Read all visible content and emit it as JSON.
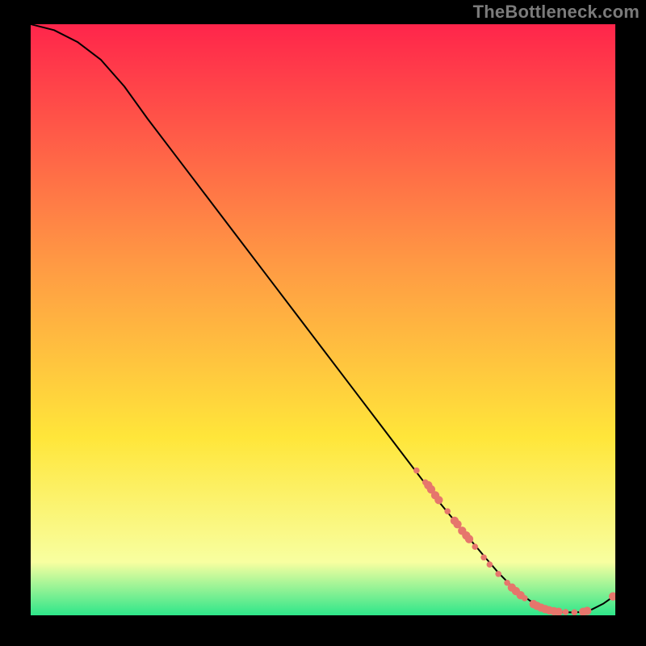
{
  "attribution": "TheBottleneck.com",
  "colors": {
    "bg": "#000000",
    "grad_top": "#ff254b",
    "grad_orange": "#ff9844",
    "grad_yellow": "#ffe63a",
    "grad_lemon": "#f8ffa0",
    "grad_green": "#2ee68a",
    "curve": "#000000",
    "marker": "#e6766c"
  },
  "chart_data": {
    "type": "line",
    "title": "",
    "xlabel": "",
    "ylabel": "",
    "xlim": [
      0,
      100
    ],
    "ylim": [
      0,
      100
    ],
    "curve": {
      "x": [
        0,
        4,
        8,
        12,
        16,
        20,
        25,
        30,
        35,
        40,
        45,
        50,
        55,
        60,
        65,
        70,
        74,
        78,
        80,
        82,
        84,
        85.5,
        87,
        88,
        89.5,
        91,
        92.5,
        94,
        96,
        98,
        100
      ],
      "y": [
        100,
        99.0,
        97.0,
        94.0,
        89.5,
        84.0,
        77.5,
        71.0,
        64.5,
        58.0,
        51.5,
        45.0,
        38.5,
        32.0,
        25.5,
        19.0,
        14.2,
        9.5,
        7.2,
        5.2,
        3.5,
        2.4,
        1.6,
        1.1,
        0.7,
        0.55,
        0.5,
        0.55,
        1.0,
        2.0,
        3.4
      ]
    },
    "markers": [
      {
        "x": 66.0,
        "y": 24.5,
        "r": 0.7
      },
      {
        "x": 67.5,
        "y": 22.5,
        "r": 0.7
      },
      {
        "x": 68.0,
        "y": 22.0,
        "r": 0.95
      },
      {
        "x": 68.5,
        "y": 21.3,
        "r": 0.95
      },
      {
        "x": 69.2,
        "y": 20.3,
        "r": 0.95
      },
      {
        "x": 69.8,
        "y": 19.5,
        "r": 0.95
      },
      {
        "x": 71.3,
        "y": 17.6,
        "r": 0.7
      },
      {
        "x": 72.5,
        "y": 16.0,
        "r": 0.95
      },
      {
        "x": 73.0,
        "y": 15.4,
        "r": 0.95
      },
      {
        "x": 73.8,
        "y": 14.3,
        "r": 0.95
      },
      {
        "x": 74.5,
        "y": 13.5,
        "r": 0.95
      },
      {
        "x": 75.0,
        "y": 12.9,
        "r": 0.95
      },
      {
        "x": 76.0,
        "y": 11.6,
        "r": 0.7
      },
      {
        "x": 77.5,
        "y": 9.8,
        "r": 0.7
      },
      {
        "x": 78.5,
        "y": 8.6,
        "r": 0.7
      },
      {
        "x": 80.0,
        "y": 7.0,
        "r": 0.7
      },
      {
        "x": 81.5,
        "y": 5.5,
        "r": 0.7
      },
      {
        "x": 82.3,
        "y": 4.7,
        "r": 0.95
      },
      {
        "x": 83.0,
        "y": 4.1,
        "r": 0.95
      },
      {
        "x": 83.8,
        "y": 3.4,
        "r": 0.95
      },
      {
        "x": 84.5,
        "y": 2.9,
        "r": 0.7
      },
      {
        "x": 86.0,
        "y": 1.9,
        "r": 0.95
      },
      {
        "x": 86.6,
        "y": 1.6,
        "r": 0.95
      },
      {
        "x": 87.3,
        "y": 1.3,
        "r": 0.95
      },
      {
        "x": 88.0,
        "y": 1.05,
        "r": 0.95
      },
      {
        "x": 88.7,
        "y": 0.85,
        "r": 0.95
      },
      {
        "x": 89.5,
        "y": 0.7,
        "r": 0.95
      },
      {
        "x": 90.3,
        "y": 0.6,
        "r": 0.95
      },
      {
        "x": 91.5,
        "y": 0.55,
        "r": 0.7
      },
      {
        "x": 93.0,
        "y": 0.5,
        "r": 0.7
      },
      {
        "x": 94.5,
        "y": 0.6,
        "r": 0.95
      },
      {
        "x": 95.2,
        "y": 0.75,
        "r": 0.95
      },
      {
        "x": 99.6,
        "y": 3.2,
        "r": 0.95
      }
    ]
  }
}
